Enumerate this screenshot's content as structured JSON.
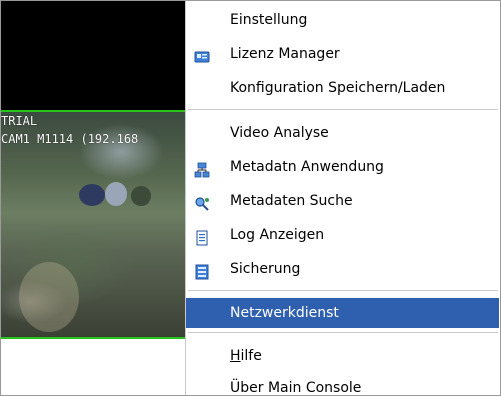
{
  "video": {
    "overlay_line1": "TRIAL",
    "overlay_line2": "CAM1 M1114 (192.168"
  },
  "menu": {
    "items": [
      {
        "label": "Einstellung",
        "icon": "none"
      },
      {
        "label": "Lizenz Manager",
        "icon": "license-card-icon"
      },
      {
        "label": "Konfiguration Speichern/Laden",
        "icon": "none"
      },
      {
        "label": "Video Analyse",
        "icon": "none"
      },
      {
        "label": "Metadatn Anwendung",
        "icon": "metadata-network-icon"
      },
      {
        "label": "Metadaten Suche",
        "icon": "metadata-search-icon"
      },
      {
        "label": "Log Anzeigen",
        "icon": "log-document-icon"
      },
      {
        "label": "Sicherung",
        "icon": "backup-icon"
      },
      {
        "label": "Netzwerkdienst",
        "icon": "none",
        "selected": true
      },
      {
        "label_first": "H",
        "label_rest": "ilfe",
        "icon": "none"
      },
      {
        "label": "Über Main Console",
        "icon": "none"
      }
    ]
  },
  "colors": {
    "selection": "#2f5faf",
    "video_border": "#27c21a"
  }
}
